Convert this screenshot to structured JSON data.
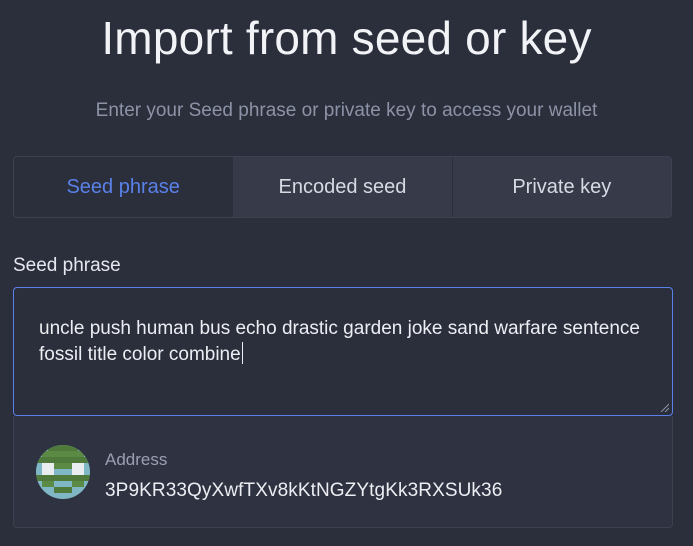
{
  "header": {
    "title": "Import from seed or key",
    "subtitle": "Enter your Seed phrase or private key to access your wallet"
  },
  "tabs": [
    {
      "label": "Seed phrase",
      "active": true
    },
    {
      "label": "Encoded seed",
      "active": false
    },
    {
      "label": "Private key",
      "active": false
    }
  ],
  "seed_field": {
    "label": "Seed phrase",
    "value": "uncle push human bus echo drastic garden joke sand warfare sentence fossil title color combine"
  },
  "address": {
    "label": "Address",
    "value": "3P9KR33QyXwfTXv8kKtNGZYtgKk3RXSUk36",
    "avatar_icon": "identicon-avatar"
  },
  "colors": {
    "background": "#2b2e3b",
    "accent": "#5a81ea",
    "muted_text": "#8d93a6",
    "tab_inactive_bg": "#363a49"
  }
}
